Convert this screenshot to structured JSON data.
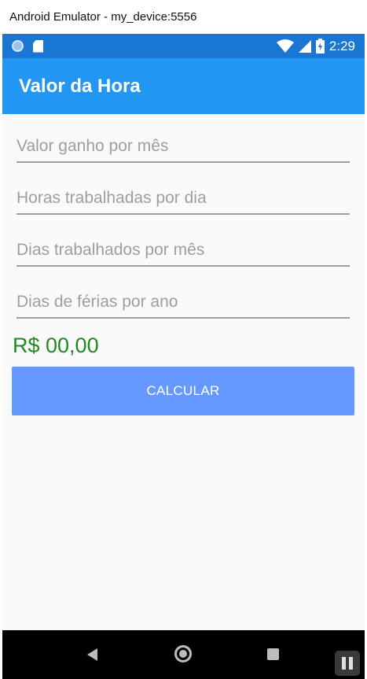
{
  "window": {
    "title": "Android Emulator - my_device:5556"
  },
  "statusbar": {
    "time": "2:29",
    "icons": [
      "sync-icon",
      "sd-card-icon",
      "wifi-icon",
      "signal-icon",
      "battery-charging-icon"
    ]
  },
  "appbar": {
    "title": "Valor da Hora"
  },
  "form": {
    "fields": [
      {
        "placeholder": "Valor ganho por mês",
        "value": ""
      },
      {
        "placeholder": "Horas trabalhadas por dia",
        "value": ""
      },
      {
        "placeholder": "Dias trabalhados por mês",
        "value": ""
      },
      {
        "placeholder": "Dias de férias por ano",
        "value": ""
      }
    ],
    "result": "R$ 00,00",
    "button_label": "CALCULAR"
  },
  "colors": {
    "statusbar": "#1976d2",
    "appbar": "#2196f3",
    "button": "#6699ff",
    "result": "#1f8a1f"
  },
  "navbar": {
    "icons": [
      "back-icon",
      "home-icon",
      "recent-apps-icon"
    ]
  }
}
